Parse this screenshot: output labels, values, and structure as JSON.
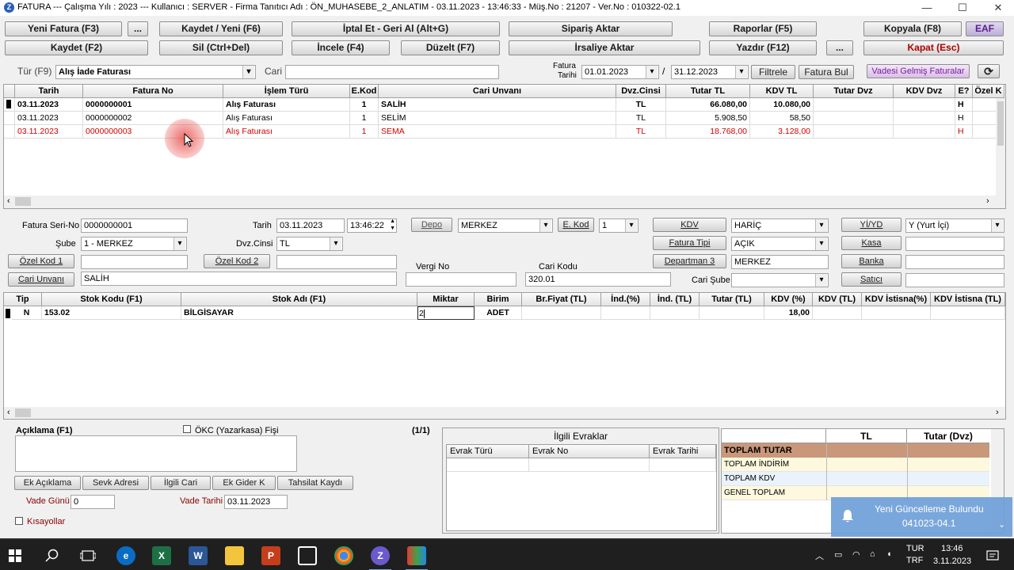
{
  "window": {
    "title": "FATURA --- Çalışma Yılı : 2023 --- Kullanıcı : SERVER - Firma Tanıtıcı Adı : ÖN_MUHASEBE_2_ANLATIM - 03.11.2023 - 13:46:33 - Müş.No : 21207 - Ver.No : 010322-02.1",
    "app_icon_letter": "Z",
    "min": "—",
    "max": "☐",
    "close": "✕"
  },
  "toolbar": {
    "yeni_fatura": "Yeni Fatura (F3)",
    "dots1": "...",
    "kaydet_yeni": "Kaydet / Yeni (F6)",
    "iptal": "İptal Et - Geri Al (Alt+G)",
    "siparis": "Sipariş Aktar",
    "raporlar": "Raporlar (F5)",
    "kopyala": "Kopyala (F8)",
    "eaf": "EAF",
    "kaydet": "Kaydet (F2)",
    "sil": "Sil (Ctrl+Del)",
    "incele": "İncele (F4)",
    "duzelt": "Düzelt (F7)",
    "irsaliye": "İrsaliye Aktar",
    "yazdir": "Yazdır (F12)",
    "dots2": "...",
    "kapat": "Kapat (Esc)"
  },
  "filter": {
    "tur_label": "Tür (F9)",
    "tur_value": "Alış İade Faturası",
    "cari_label": "Cari",
    "cari_value": "",
    "fatura_tarihi_label1": "Fatura",
    "fatura_tarihi_label2": "Tarihi",
    "date_from": "01.01.2023",
    "slash": "/",
    "date_to": "31.12.2023",
    "filtrele": "Filtrele",
    "fatura_bul": "Fatura Bul",
    "vadesi": "Vadesi Gelmiş Faturalar",
    "refresh_icon": "⟳"
  },
  "invoice_grid": {
    "headers": [
      "Tarih",
      "Fatura No",
      "İşlem Türü",
      "E.Kod",
      "Cari Unvanı",
      "Dvz.Cinsi",
      "Tutar TL",
      "KDV TL",
      "Tutar Dvz",
      "KDV Dvz",
      "E?",
      "Özel K"
    ],
    "rows": [
      {
        "tarih": "03.11.2023",
        "no": "0000000001",
        "tur": "Alış Faturası",
        "ekod": "1",
        "cari": "SALİH",
        "dvz": "TL",
        "tutar": "66.080,00",
        "kdv": "10.080,00",
        "tdvz": "",
        "kdvz": "",
        "e": "H",
        "ozel": ""
      },
      {
        "tarih": "03.11.2023",
        "no": "0000000002",
        "tur": "Alış Faturası",
        "ekod": "1",
        "cari": "SELİM",
        "dvz": "TL",
        "tutar": "5.908,50",
        "kdv": "58,50",
        "tdvz": "",
        "kdvz": "",
        "e": "H",
        "ozel": ""
      },
      {
        "tarih": "03.11.2023",
        "no": "0000000003",
        "tur": "Alış Faturası",
        "ekod": "1",
        "cari": "SEMA",
        "dvz": "TL",
        "tutar": "18.768,00",
        "kdv": "3.128,00",
        "tdvz": "",
        "kdvz": "",
        "e": "H",
        "ozel": ""
      }
    ]
  },
  "form": {
    "seri_no_label": "Fatura Seri-No",
    "seri_no": "0000000001",
    "tarih_label": "Tarih",
    "tarih": "03.11.2023",
    "saat": "13:46:22",
    "depo_btn": "Depo",
    "depo": "MERKEZ",
    "ekod_btn": "E. Kod",
    "ekod": "1",
    "kdv_btn": "KDV",
    "kdv": "HARİÇ",
    "yiyd_btn": "Yİ/YD",
    "yiyd": "Y (Yurt İçi)",
    "sube_label": "Şube",
    "sube": "1 - MERKEZ",
    "dvz_label": "Dvz.Cinsi",
    "dvz": "TL",
    "fatura_tipi_btn": "Fatura Tipi",
    "fatura_tipi": "AÇIK",
    "kasa_btn": "Kasa",
    "kasa": "",
    "ozel1_btn": "Özel Kod 1",
    "ozel1": "",
    "ozel2_btn": "Özel Kod 2",
    "ozel2": "",
    "departman_btn": "Departman 3",
    "departman": "MERKEZ",
    "banka_btn": "Banka",
    "banka": "",
    "vergi_label": "Vergi No",
    "vergi": "",
    "cari_kodu_label": "Cari Kodu",
    "cari_kodu": "320.01",
    "cari_unvani_btn": "Cari Unvanı",
    "cari_unvani": "SALİH",
    "cari_sube_label": "Cari Şube",
    "cari_sube": "",
    "satici_btn": "Satıcı",
    "satici": ""
  },
  "line_grid": {
    "headers": [
      "Tip",
      "Stok Kodu (F1)",
      "Stok Adı (F1)",
      "Miktar",
      "Birim",
      "Br.Fiyat (TL)",
      "İnd.(%)",
      "İnd. (TL)",
      "Tutar (TL)",
      "KDV (%)",
      "KDV (TL)",
      "KDV İstisna(%)",
      "KDV İstisna (TL)"
    ],
    "row": {
      "tip": "N",
      "kod": "153.02",
      "ad": "BİLGİSAYAR",
      "miktar": "2",
      "birim": "ADET",
      "fiyat": "",
      "ind": "",
      "indtl": "",
      "tutar": "",
      "kdvp": "18,00",
      "kdvtl": "",
      "ist": "",
      "isttl": ""
    }
  },
  "bottom": {
    "aciklama_label": "Açıklama (F1)",
    "okc_label": "ÖKC (Yazarkasa) Fişi",
    "page": "(1/1)",
    "ek_aciklama": "Ek Açıklama",
    "sevk": "Sevk Adresi",
    "ilgili_cari": "İlgili Cari",
    "ek_gider": "Ek Gider K",
    "tahsilat": "Tahsilat Kaydı",
    "vade_gunu_label": "Vade Günü",
    "vade_gunu": "0",
    "vade_tarihi_label": "Vade Tarihi",
    "vade_tarihi": "03.11.2023",
    "kisayollar": "Kısayollar"
  },
  "evraklar": {
    "title": "İlgili Evraklar",
    "headers": [
      "Evrak Türü",
      "Evrak No",
      "Evrak Tarihi"
    ]
  },
  "totals": {
    "col_tl": "TL",
    "col_dvz": "Tutar (Dvz)",
    "rows": [
      "TOPLAM TUTAR",
      "TOPLAM İNDİRİM",
      "TOPLAM KDV",
      "GENEL TOPLAM"
    ]
  },
  "notification": {
    "line1": "Yeni Güncelleme Bulundu",
    "line2": "041023-04.1"
  },
  "taskbar": {
    "lang1": "TUR",
    "lang2": "TRF",
    "time": "13:46",
    "date": "3.11.2023"
  },
  "colors": {
    "cursor_highlight": "#e53935",
    "red_row": "#d40000",
    "total_header": "#c9977a",
    "notification": "#6f9fd8"
  }
}
